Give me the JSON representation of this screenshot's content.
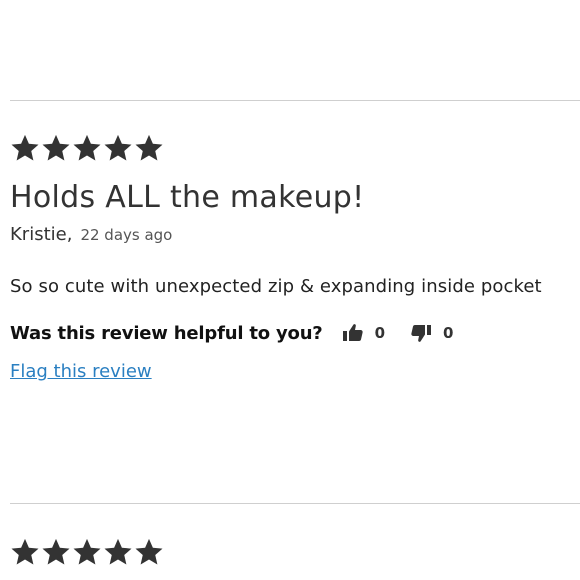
{
  "colors": {
    "star": "#333333",
    "link": "#2a7fc1",
    "divider": "#cfcfcf"
  },
  "reviews": [
    {
      "rating": 5,
      "max_rating": 5,
      "title": "Holds ALL the makeup!",
      "author": "Kristie,",
      "date": "22 days ago",
      "body": "So so cute with unexpected zip & expanding inside pocket",
      "helpful_question": "Was this review helpful to you?",
      "thumbs_up_icon": "thumbs-up-icon",
      "thumbs_up_count": "0",
      "thumbs_down_icon": "thumbs-down-icon",
      "thumbs_down_count": "0",
      "flag_label": "Flag this review"
    },
    {
      "rating": 5,
      "max_rating": 5
    }
  ]
}
